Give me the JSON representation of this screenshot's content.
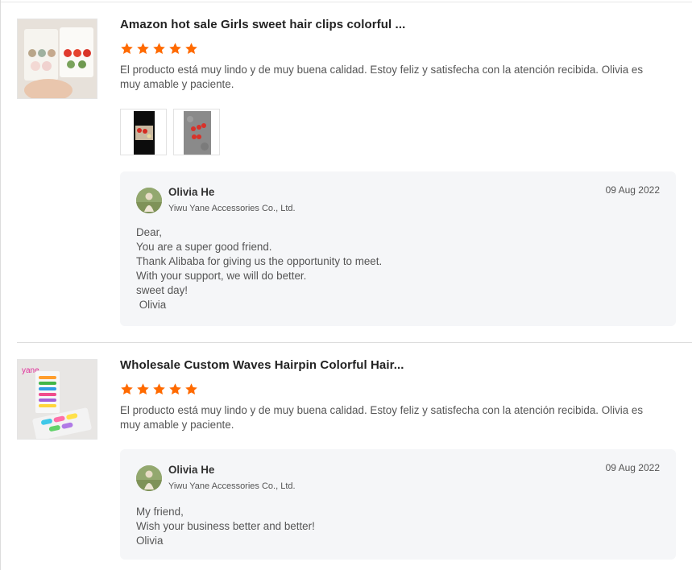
{
  "reviews": [
    {
      "title": "Amazon hot sale Girls sweet hair clips colorful ...",
      "rating": 5,
      "comment": "El producto está muy lindo y de muy buena calidad. Estoy feliz y satisfecha con la atención recibida. Olivia es muy amable y paciente.",
      "reply": {
        "name": "Olivia He",
        "company": "Yiwu Yane Accessories Co., Ltd.",
        "date": "09 Aug 2022",
        "lines": [
          "Dear,",
          "You are a super good friend.",
          "Thank Alibaba for giving us the opportunity to meet.",
          "With your support, we will do better.",
          "sweet day!",
          " Olivia"
        ]
      }
    },
    {
      "title": "Wholesale Custom Waves Hairpin Colorful Hair...",
      "rating": 5,
      "comment": "El producto está muy lindo y de muy buena calidad. Estoy feliz y satisfecha con la atención recibida. Olivia es muy amable y paciente.",
      "thumb_text": "yane",
      "reply": {
        "name": "Olivia He",
        "company": "Yiwu Yane Accessories Co., Ltd.",
        "date": "09 Aug 2022",
        "lines": [
          "My friend,",
          "Wish your business better and better!",
          "Olivia"
        ]
      }
    }
  ],
  "colors": {
    "star": "#ff6a00",
    "reply_bg": "#f5f6f8"
  }
}
